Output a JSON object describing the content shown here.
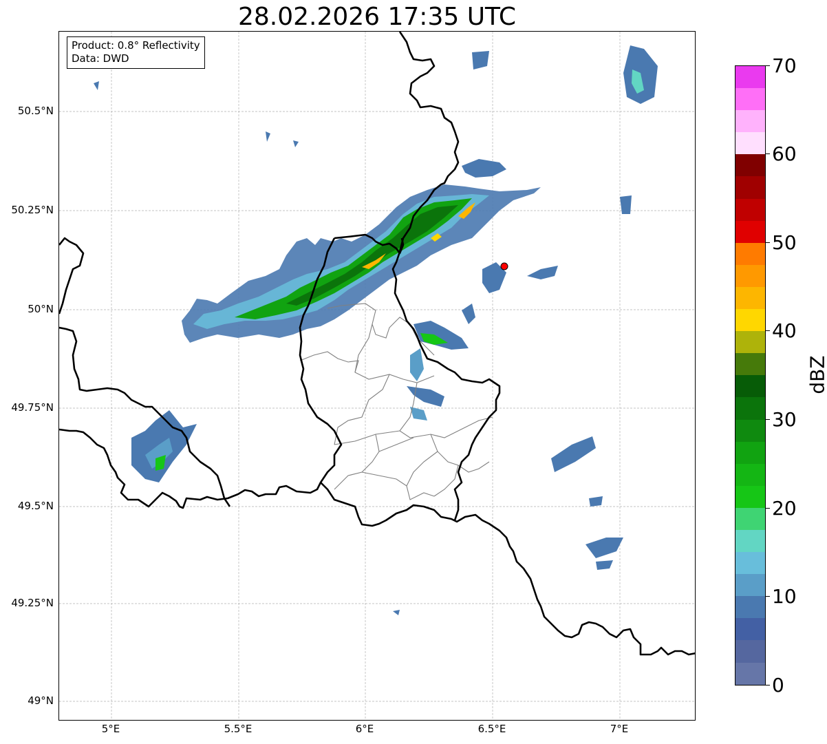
{
  "title": "28.02.2026 17:35 UTC",
  "infobox": {
    "product": "Product: 0.8° Reflectivity",
    "data": "Data: DWD"
  },
  "chart_data": {
    "type": "heatmap",
    "title": "28.02.2026 17:35 UTC",
    "x_ticks": [
      "5°E",
      "5.5°E",
      "6°E",
      "6.5°E",
      "7°E"
    ],
    "y_ticks": [
      "50.5°N",
      "50.25°N",
      "50°N",
      "49.75°N",
      "49.5°N",
      "49.25°N",
      "49°N"
    ],
    "xlim": [
      4.8,
      7.3
    ],
    "ylim": [
      48.95,
      50.7
    ],
    "grid": true,
    "colorbar": {
      "label": "dBZ",
      "ticks": [
        "0",
        "10",
        "20",
        "30",
        "40",
        "50",
        "60",
        "70"
      ],
      "range": [
        0,
        70
      ],
      "step": 2.5
    },
    "radar_site": {
      "lon": 6.55,
      "lat": 50.11
    }
  },
  "colors": {
    "colorbar_bins": [
      "#6676a8",
      "#55679f",
      "#4360a4",
      "#4a79b0",
      "#5a9ec8",
      "#68bedb",
      "#62d6c3",
      "#3fd473",
      "#16c616",
      "#14b614",
      "#11a311",
      "#0f8a0f",
      "#0b740b",
      "#075c07",
      "#467a0a",
      "#aeb30a",
      "#ffd700",
      "#fdb600",
      "#ff9900",
      "#ff7b00",
      "#e00000",
      "#c00000",
      "#a00000",
      "#800000",
      "#ffdffe",
      "#ffb2fc",
      "#ff6ff7",
      "#ea3aef"
    ],
    "border": "#000000",
    "admin": "#808080",
    "grid": "#b0b0b0",
    "marker": "#ff0000"
  }
}
